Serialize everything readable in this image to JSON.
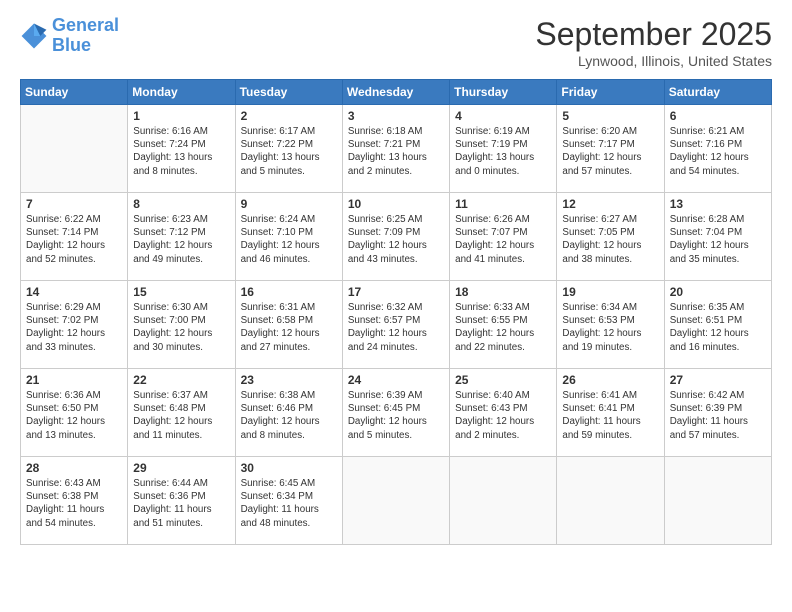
{
  "header": {
    "logo_line1": "General",
    "logo_line2": "Blue",
    "month_title": "September 2025",
    "location": "Lynwood, Illinois, United States"
  },
  "days_of_week": [
    "Sunday",
    "Monday",
    "Tuesday",
    "Wednesday",
    "Thursday",
    "Friday",
    "Saturday"
  ],
  "weeks": [
    [
      {
        "day": "",
        "info": ""
      },
      {
        "day": "1",
        "info": "Sunrise: 6:16 AM\nSunset: 7:24 PM\nDaylight: 13 hours\nand 8 minutes."
      },
      {
        "day": "2",
        "info": "Sunrise: 6:17 AM\nSunset: 7:22 PM\nDaylight: 13 hours\nand 5 minutes."
      },
      {
        "day": "3",
        "info": "Sunrise: 6:18 AM\nSunset: 7:21 PM\nDaylight: 13 hours\nand 2 minutes."
      },
      {
        "day": "4",
        "info": "Sunrise: 6:19 AM\nSunset: 7:19 PM\nDaylight: 13 hours\nand 0 minutes."
      },
      {
        "day": "5",
        "info": "Sunrise: 6:20 AM\nSunset: 7:17 PM\nDaylight: 12 hours\nand 57 minutes."
      },
      {
        "day": "6",
        "info": "Sunrise: 6:21 AM\nSunset: 7:16 PM\nDaylight: 12 hours\nand 54 minutes."
      }
    ],
    [
      {
        "day": "7",
        "info": "Sunrise: 6:22 AM\nSunset: 7:14 PM\nDaylight: 12 hours\nand 52 minutes."
      },
      {
        "day": "8",
        "info": "Sunrise: 6:23 AM\nSunset: 7:12 PM\nDaylight: 12 hours\nand 49 minutes."
      },
      {
        "day": "9",
        "info": "Sunrise: 6:24 AM\nSunset: 7:10 PM\nDaylight: 12 hours\nand 46 minutes."
      },
      {
        "day": "10",
        "info": "Sunrise: 6:25 AM\nSunset: 7:09 PM\nDaylight: 12 hours\nand 43 minutes."
      },
      {
        "day": "11",
        "info": "Sunrise: 6:26 AM\nSunset: 7:07 PM\nDaylight: 12 hours\nand 41 minutes."
      },
      {
        "day": "12",
        "info": "Sunrise: 6:27 AM\nSunset: 7:05 PM\nDaylight: 12 hours\nand 38 minutes."
      },
      {
        "day": "13",
        "info": "Sunrise: 6:28 AM\nSunset: 7:04 PM\nDaylight: 12 hours\nand 35 minutes."
      }
    ],
    [
      {
        "day": "14",
        "info": "Sunrise: 6:29 AM\nSunset: 7:02 PM\nDaylight: 12 hours\nand 33 minutes."
      },
      {
        "day": "15",
        "info": "Sunrise: 6:30 AM\nSunset: 7:00 PM\nDaylight: 12 hours\nand 30 minutes."
      },
      {
        "day": "16",
        "info": "Sunrise: 6:31 AM\nSunset: 6:58 PM\nDaylight: 12 hours\nand 27 minutes."
      },
      {
        "day": "17",
        "info": "Sunrise: 6:32 AM\nSunset: 6:57 PM\nDaylight: 12 hours\nand 24 minutes."
      },
      {
        "day": "18",
        "info": "Sunrise: 6:33 AM\nSunset: 6:55 PM\nDaylight: 12 hours\nand 22 minutes."
      },
      {
        "day": "19",
        "info": "Sunrise: 6:34 AM\nSunset: 6:53 PM\nDaylight: 12 hours\nand 19 minutes."
      },
      {
        "day": "20",
        "info": "Sunrise: 6:35 AM\nSunset: 6:51 PM\nDaylight: 12 hours\nand 16 minutes."
      }
    ],
    [
      {
        "day": "21",
        "info": "Sunrise: 6:36 AM\nSunset: 6:50 PM\nDaylight: 12 hours\nand 13 minutes."
      },
      {
        "day": "22",
        "info": "Sunrise: 6:37 AM\nSunset: 6:48 PM\nDaylight: 12 hours\nand 11 minutes."
      },
      {
        "day": "23",
        "info": "Sunrise: 6:38 AM\nSunset: 6:46 PM\nDaylight: 12 hours\nand 8 minutes."
      },
      {
        "day": "24",
        "info": "Sunrise: 6:39 AM\nSunset: 6:45 PM\nDaylight: 12 hours\nand 5 minutes."
      },
      {
        "day": "25",
        "info": "Sunrise: 6:40 AM\nSunset: 6:43 PM\nDaylight: 12 hours\nand 2 minutes."
      },
      {
        "day": "26",
        "info": "Sunrise: 6:41 AM\nSunset: 6:41 PM\nDaylight: 11 hours\nand 59 minutes."
      },
      {
        "day": "27",
        "info": "Sunrise: 6:42 AM\nSunset: 6:39 PM\nDaylight: 11 hours\nand 57 minutes."
      }
    ],
    [
      {
        "day": "28",
        "info": "Sunrise: 6:43 AM\nSunset: 6:38 PM\nDaylight: 11 hours\nand 54 minutes."
      },
      {
        "day": "29",
        "info": "Sunrise: 6:44 AM\nSunset: 6:36 PM\nDaylight: 11 hours\nand 51 minutes."
      },
      {
        "day": "30",
        "info": "Sunrise: 6:45 AM\nSunset: 6:34 PM\nDaylight: 11 hours\nand 48 minutes."
      },
      {
        "day": "",
        "info": ""
      },
      {
        "day": "",
        "info": ""
      },
      {
        "day": "",
        "info": ""
      },
      {
        "day": "",
        "info": ""
      }
    ]
  ]
}
